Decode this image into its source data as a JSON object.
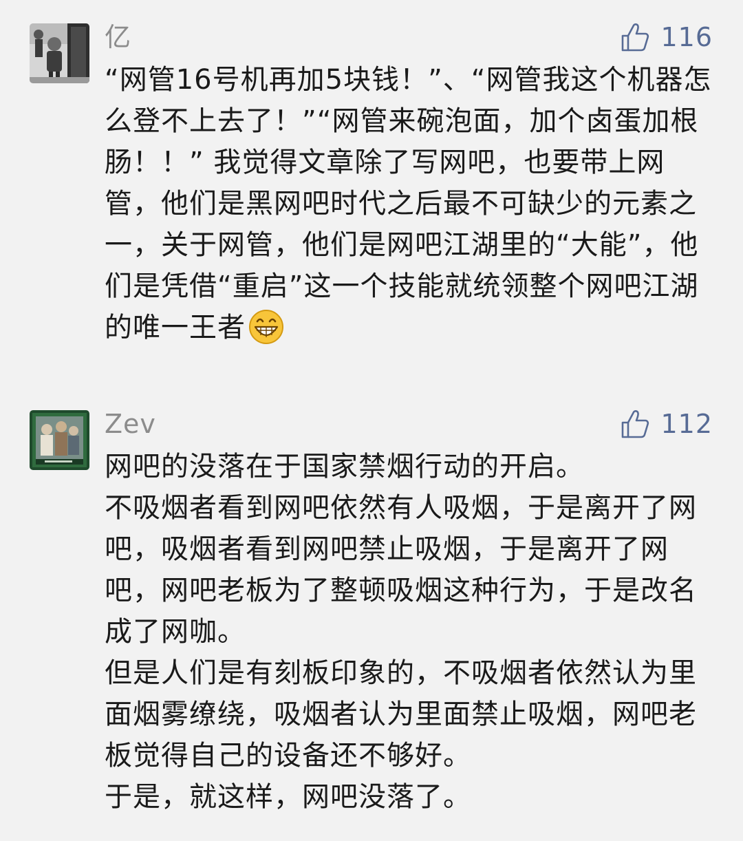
{
  "comments": [
    {
      "username": "亿",
      "like_count": "116",
      "content": [
        "“网管16号机再加5块钱！”、“网管我这个机器怎么登不上去了！”“网管来碗泡面，加个卤蛋加根肠！！” 我觉得文章除了写网吧，也要带上网管，他们是黑网吧时代之后最不可缺少的元素之一，关于网管，他们是网吧江湖里的“大能”，他们是凭借“重启”这一个技能就统领整个网吧江湖的唯一王者"
      ],
      "avatar_icon": "avatar-photo-child",
      "trailing_icon": "grin-emoji-icon"
    },
    {
      "username": "Zev",
      "like_count": "112",
      "content": [
        "网吧的没落在于国家禁烟行动的开启。",
        "不吸烟者看到网吧依然有人吸烟，于是离开了网吧，吸烟者看到网吧禁止吸烟，于是离开了网吧，网吧老板为了整顿吸烟这种行为，于是改名成了网咖。",
        "但是人们是有刻板印象的，不吸烟者依然认为里面烟雾缭绕，吸烟者认为里面禁止吸烟，网吧老板觉得自己的设备还不够好。",
        "于是，就这样，网吧没落了。"
      ],
      "avatar_icon": "avatar-photo-card"
    }
  ],
  "colors": {
    "background": "#f2f2f2",
    "username": "#8c8c8c",
    "like": "#576b95",
    "text": "#1a1a1a"
  }
}
